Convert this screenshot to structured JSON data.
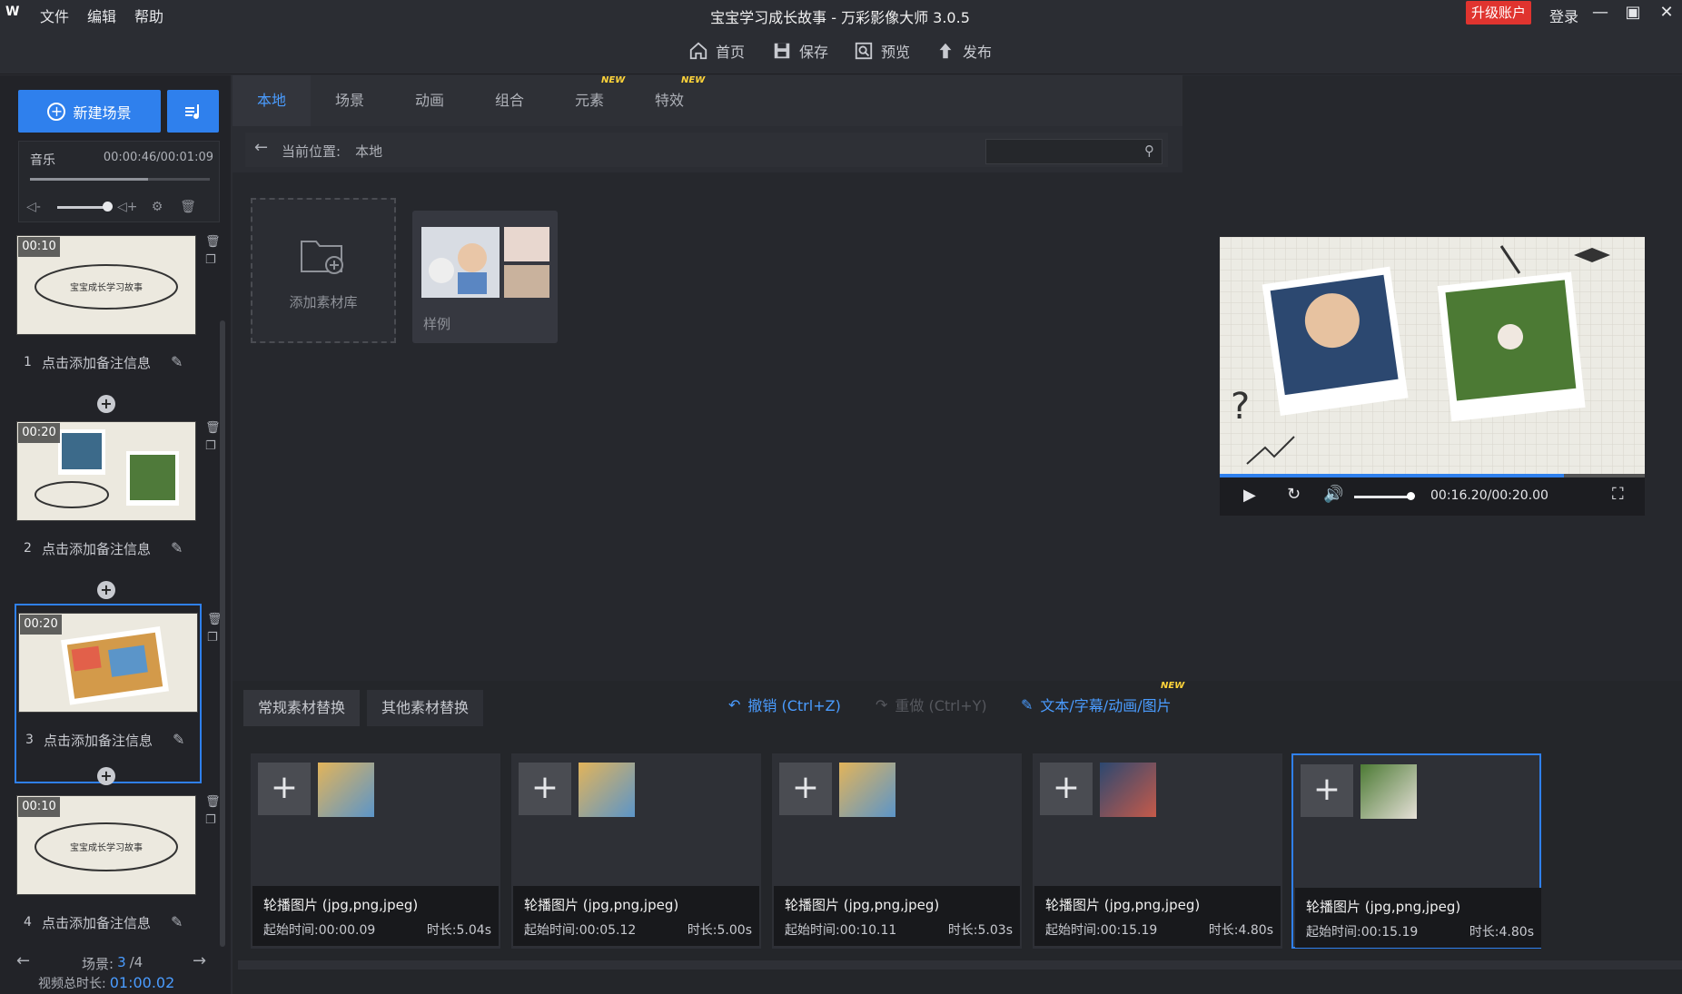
{
  "title_bar": {
    "logo": "W",
    "menu": [
      "文件",
      "编辑",
      "帮助"
    ],
    "title": "宝宝学习成长故事 - 万彩影像大师 3.0.5",
    "upgrade": "升级账户",
    "login": "登录"
  },
  "toolbar": {
    "home": "首页",
    "save": "保存",
    "preview": "预览",
    "publish": "发布"
  },
  "left": {
    "new_scene": "新建场景",
    "music": {
      "label": "音乐",
      "time": "00:00:46/00:01:09"
    },
    "scenes": [
      {
        "time": "00:10",
        "index": "1",
        "note": "点击添加备注信息"
      },
      {
        "time": "00:20",
        "index": "2",
        "note": "点击添加备注信息"
      },
      {
        "time": "00:20",
        "index": "3",
        "note": "点击添加备注信息"
      },
      {
        "time": "00:10",
        "index": "4",
        "note": "点击添加备注信息"
      }
    ],
    "nav": {
      "label": "场景:",
      "current": "3",
      "total": "/4",
      "total_label": "视频总时长:",
      "total_time": "01:00.02"
    }
  },
  "library": {
    "tabs": [
      {
        "label": "本地",
        "new": ""
      },
      {
        "label": "场景",
        "new": ""
      },
      {
        "label": "动画",
        "new": ""
      },
      {
        "label": "组合",
        "new": ""
      },
      {
        "label": "元素",
        "new": "NEW"
      },
      {
        "label": "特效",
        "new": "NEW"
      }
    ],
    "location_label": "当前位置:",
    "location": "本地",
    "add_lib": "添加素材库",
    "sample": "样例"
  },
  "preview": {
    "time": "00:16.20/00:20.00",
    "progress": 0.81,
    "volume": 0.95
  },
  "bottom": {
    "tabs": [
      "常规素材替换",
      "其他素材替换"
    ],
    "undo": "撤销 (Ctrl+Z)",
    "redo": "重做 (Ctrl+Y)",
    "text_edit": "文本/字幕/动画/图片",
    "new_badge": "NEW",
    "cards": [
      {
        "title": "轮播图片 (jpg,png,jpeg)",
        "start": "起始时间:00:00.09",
        "duration": "时长:5.04s"
      },
      {
        "title": "轮播图片 (jpg,png,jpeg)",
        "start": "起始时间:00:05.12",
        "duration": "时长:5.00s"
      },
      {
        "title": "轮播图片 (jpg,png,jpeg)",
        "start": "起始时间:00:10.11",
        "duration": "时长:5.03s"
      },
      {
        "title": "轮播图片 (jpg,png,jpeg)",
        "start": "起始时间:00:15.19",
        "duration": "时长:4.80s"
      },
      {
        "title": "轮播图片 (jpg,png,jpeg)",
        "start": "起始时间:00:15.19",
        "duration": "时长:4.80s"
      }
    ]
  },
  "colors": {
    "accent": "#2f80ed",
    "upgrade": "#e0342f",
    "bg": "#2b2d33"
  }
}
